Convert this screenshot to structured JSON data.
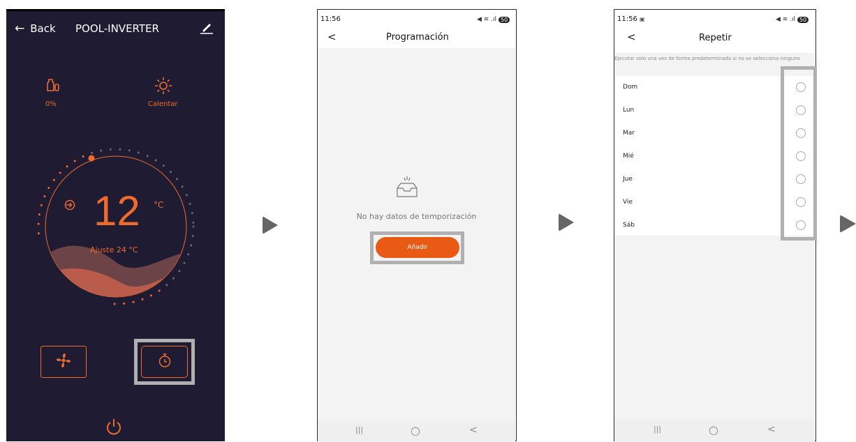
{
  "panel1": {
    "back_label": "Back",
    "back_icon": "arrow-left-icon",
    "title": "POOL-INVERTER",
    "edit_icon": "pencil-icon",
    "left_stat": {
      "icon": "bottle-icon",
      "value": "0%"
    },
    "right_stat": {
      "icon": "sun-icon",
      "value": "Calentar"
    },
    "temperature": "12",
    "unit": "°C",
    "setpoint": "Ajuste 24 °C",
    "fan_icon": "fan-icon",
    "timer_icon": "timer-icon",
    "power_icon": "power-icon",
    "accent": "#ef6b2c",
    "background": "#1e1b33"
  },
  "panel2": {
    "time": "11:56",
    "status_icons": "signal-wifi-battery",
    "battery": "50",
    "title": "Programación",
    "empty_text": "No hay datos de temporización",
    "add_button": "Añadir",
    "nav_recent": "|||",
    "nav_home": "○",
    "nav_back": "<"
  },
  "panel3": {
    "time": "11:56",
    "battery": "50",
    "title": "Repetir",
    "hint": "Ejecutar solo una vez de forma predeterminada si no se selecciona ninguno",
    "days": [
      "Dom",
      "Lun",
      "Mar",
      "Mié",
      "Jue",
      "Vie",
      "Sáb"
    ],
    "nav_recent": "|||",
    "nav_home": "○",
    "nav_back": "<"
  }
}
